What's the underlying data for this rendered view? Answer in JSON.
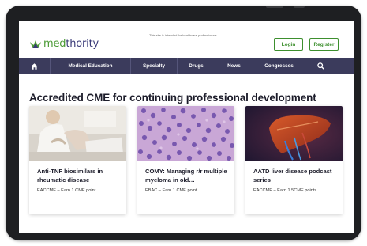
{
  "header": {
    "logo_med": "med",
    "logo_rest": "thority",
    "notice": "This site is intended for healthcare professionals",
    "login_label": "Login",
    "register_label": "Register"
  },
  "nav": {
    "items": [
      {
        "label": ""
      },
      {
        "label": "Medical Education"
      },
      {
        "label": "Specialty"
      },
      {
        "label": "Drugs"
      },
      {
        "label": "News"
      },
      {
        "label": "Congresses"
      },
      {
        "label": ""
      }
    ]
  },
  "main": {
    "title": "Accredited CME for continuing professional development",
    "cards": [
      {
        "title": "Anti-TNF biosimilars in rheumatic disease",
        "meta": "EACCME – Earn 1 CME point"
      },
      {
        "title": "COMY: Managing r/r multiple myeloma in old…",
        "meta": "EBAC – Earn 1 CME point"
      },
      {
        "title": "AATD liver disease podcast series",
        "meta": "EACCME – Earn 1.5CME points"
      }
    ]
  },
  "colors": {
    "brand_green": "#4a9a34",
    "brand_navy": "#3a3a78",
    "nav_bg": "#3b3b5c",
    "button_border": "#3d8f2e"
  },
  "icons": {
    "home": "home-icon",
    "search": "search-icon",
    "logo": "logo-crown-icon"
  }
}
